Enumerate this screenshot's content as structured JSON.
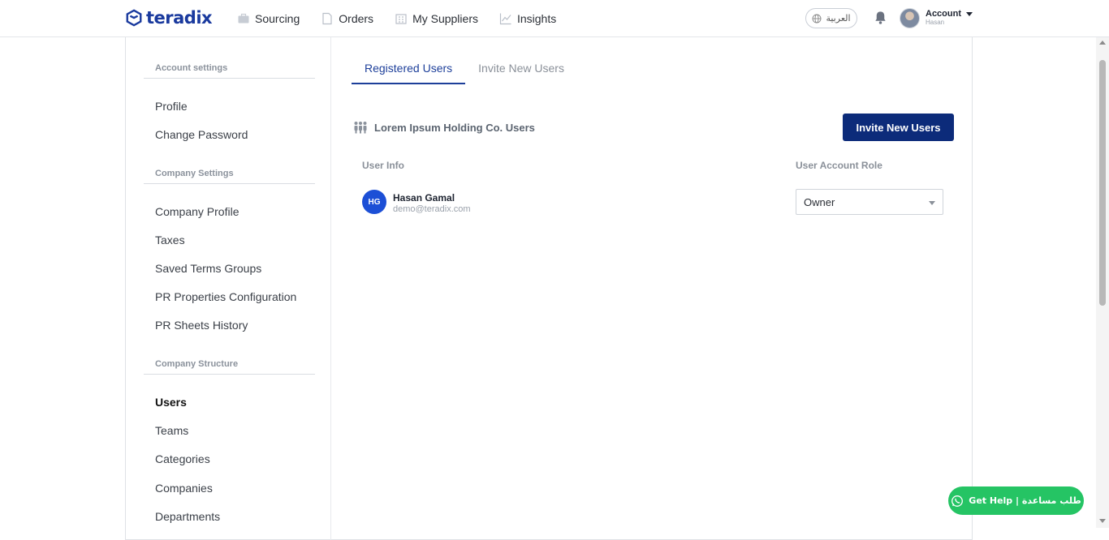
{
  "brand": {
    "name": "teradix"
  },
  "nav": [
    {
      "label": "Sourcing",
      "icon": "briefcase-icon"
    },
    {
      "label": "Orders",
      "icon": "document-icon"
    },
    {
      "label": "My Suppliers",
      "icon": "building-icon"
    },
    {
      "label": "Insights",
      "icon": "chart-line-icon"
    }
  ],
  "header": {
    "language_label": "العربية",
    "account_label": "Account",
    "account_user": "Hasan"
  },
  "sidebar": {
    "sections": [
      {
        "title": "Account settings",
        "items": [
          "Profile",
          "Change Password"
        ]
      },
      {
        "title": "Company Settings",
        "items": [
          "Company Profile",
          "Taxes",
          "Saved Terms Groups",
          "PR Properties Configuration",
          "PR Sheets History"
        ]
      },
      {
        "title": "Company Structure",
        "items": [
          "Users",
          "Teams",
          "Categories",
          "Companies",
          "Departments"
        ]
      }
    ],
    "active_item": "Users"
  },
  "tabs": [
    {
      "label": "Registered Users",
      "active": true
    },
    {
      "label": "Invite New Users",
      "active": false
    }
  ],
  "main": {
    "company_title": "Lorem Ipsum Holding Co. Users",
    "invite_button": "Invite New Users",
    "columns": [
      "User Info",
      "User Account Role"
    ],
    "users": [
      {
        "initials": "HG",
        "name": "Hasan Gamal",
        "email": "demo@teradix.com",
        "role": "Owner"
      }
    ]
  },
  "help_button": {
    "label": "Get Help | طلب مساعدة"
  },
  "colors": {
    "brand": "#1a3a9e",
    "primary_button": "#0c2b7a",
    "help": "#25c464",
    "avatar": "#1c4fd6"
  }
}
